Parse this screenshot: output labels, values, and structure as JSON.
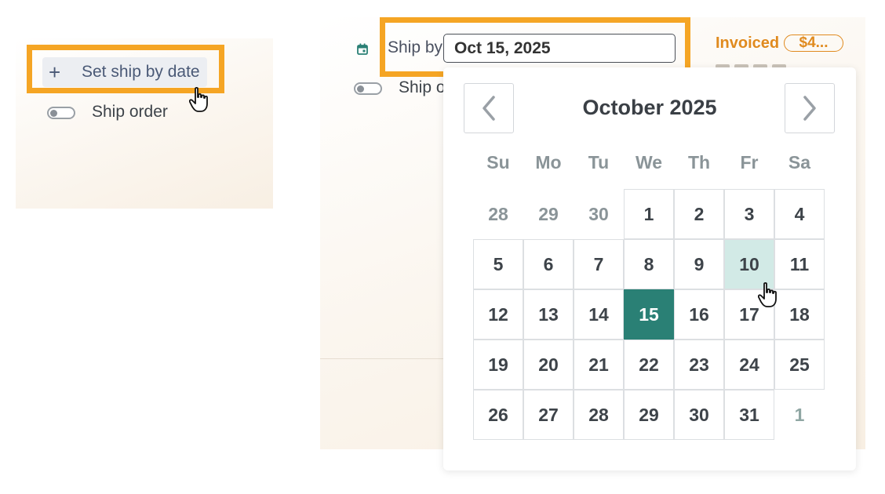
{
  "left": {
    "set_ship_by_label": "Set ship by date",
    "plus_icon": "+",
    "ship_order_label": "Ship order"
  },
  "header": {
    "ship_by_label": "Ship by",
    "ship_by_value": "Oct 15, 2025",
    "ship_order_label": "Ship o",
    "invoiced_label": "Invoiced",
    "invoiced_amount": "$4..."
  },
  "calendar": {
    "month_title": "October 2025",
    "prev_icon": "chevron-left-icon",
    "next_icon": "chevron-right-icon",
    "weekdays": [
      "Su",
      "Mo",
      "Tu",
      "We",
      "Th",
      "Fr",
      "Sa"
    ],
    "weeks": [
      [
        "28",
        "29",
        "30",
        "1",
        "2",
        "3",
        "4"
      ],
      [
        "5",
        "6",
        "7",
        "8",
        "9",
        "10",
        "11"
      ],
      [
        "12",
        "13",
        "14",
        "15",
        "16",
        "17",
        "18"
      ],
      [
        "19",
        "20",
        "21",
        "22",
        "23",
        "24",
        "25"
      ],
      [
        "26",
        "27",
        "28",
        "29",
        "30",
        "31",
        "1"
      ]
    ],
    "selected_day": "15",
    "hovered_day": "10"
  },
  "colors": {
    "highlight": "#f5a524",
    "selected": "#2a8075",
    "hover": "#d2eae6",
    "invoiced": "#e08a1e"
  }
}
